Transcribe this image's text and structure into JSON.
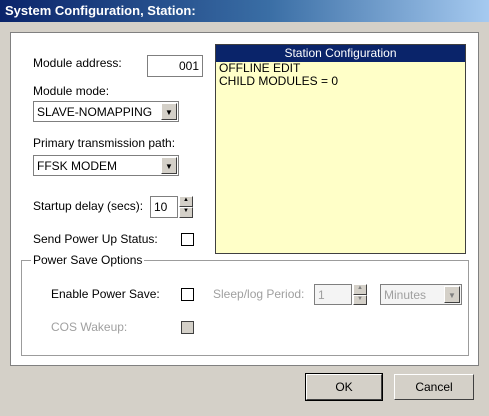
{
  "window": {
    "title": "System Configuration, Station:"
  },
  "module_address": {
    "label": "Module address:",
    "value": "001"
  },
  "module_mode": {
    "label": "Module mode:",
    "selected": "SLAVE-NOMAPPING"
  },
  "transmission_path": {
    "label": "Primary transmission path:",
    "selected": "FFSK MODEM"
  },
  "startup_delay": {
    "label": "Startup delay (secs):",
    "value": "10"
  },
  "send_power_up": {
    "label": "Send Power Up Status:",
    "checked": false
  },
  "station_config": {
    "header": "Station Configuration",
    "lines": [
      "OFFLINE EDIT",
      "CHILD MODULES = 0"
    ]
  },
  "power_save": {
    "group_label": "Power Save Options",
    "enable_label": "Enable Power Save:",
    "enable_checked": false,
    "sleep_label": "Sleep/log Period:",
    "sleep_value": "1",
    "sleep_unit": "Minutes",
    "cos_label": "COS Wakeup:",
    "cos_checked": false
  },
  "buttons": {
    "ok": "OK",
    "cancel": "Cancel"
  }
}
